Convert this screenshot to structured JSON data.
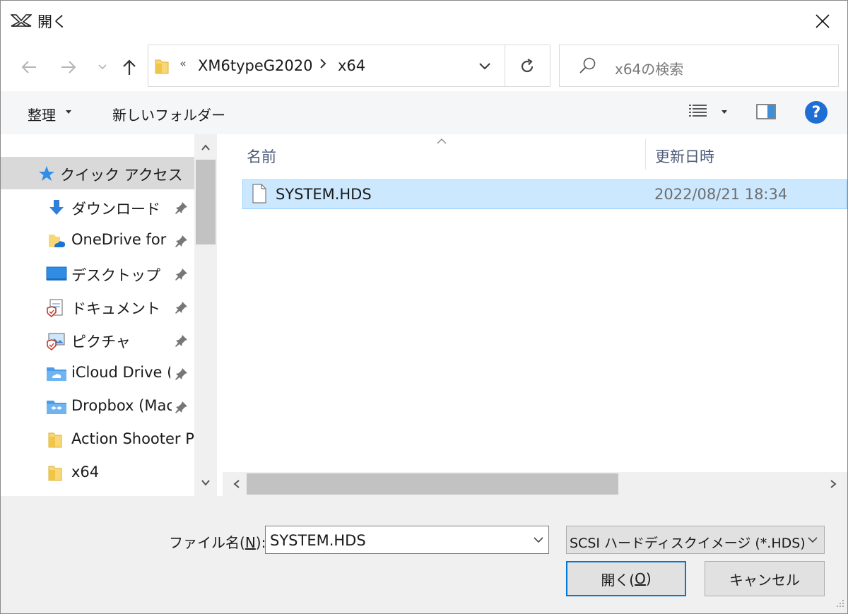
{
  "window": {
    "title": "開く",
    "app_icon": "xm6-logo-icon",
    "close_icon": "close-icon"
  },
  "nav": {
    "back_icon": "arrow-left-icon",
    "forward_icon": "arrow-right-icon",
    "recent_icon": "chevron-down-icon",
    "up_icon": "arrow-up-icon",
    "address": {
      "overflow": "«",
      "crumbs": [
        "XM6typeG2020",
        "x64"
      ]
    },
    "refresh_icon": "refresh-icon",
    "search_placeholder": "x64の検索"
  },
  "toolbar": {
    "organize": "整理",
    "new_folder": "新しいフォルダー",
    "view_icon": "details-view-icon",
    "preview_icon": "preview-pane-icon",
    "help": "?"
  },
  "navpane": {
    "items": [
      {
        "label": "クイック アクセス",
        "icon": "star-icon",
        "pinned": false,
        "selected": true
      },
      {
        "label": "ダウンロード",
        "icon": "download-icon",
        "pinned": true
      },
      {
        "label": "OneDrive for",
        "icon": "onedrive-folder-icon",
        "pinned": true
      },
      {
        "label": "デスクトップ",
        "icon": "desktop-icon",
        "pinned": true
      },
      {
        "label": "ドキュメント",
        "icon": "documents-icon",
        "pinned": true
      },
      {
        "label": "ピクチャ",
        "icon": "pictures-icon",
        "pinned": true
      },
      {
        "label": "iCloud Drive (",
        "icon": "icloud-folder-icon",
        "pinned": true
      },
      {
        "label": "Dropbox (Mac",
        "icon": "dropbox-folder-icon",
        "pinned": true
      },
      {
        "label": "Action Shooter P",
        "icon": "folder-icon",
        "pinned": false
      },
      {
        "label": "x64",
        "icon": "folder-icon",
        "pinned": false
      }
    ]
  },
  "files": {
    "columns": {
      "name": "名前",
      "date": "更新日時"
    },
    "rows": [
      {
        "name": "SYSTEM.HDS",
        "date": "2022/08/21 18:34",
        "selected": true
      }
    ]
  },
  "bottom": {
    "filename_label": "ファイル名(",
    "filename_accel": "N",
    "filename_label_end": "):",
    "filename_value": "SYSTEM.HDS",
    "filetype": "SCSI ハードディスクイメージ (*.HDS)",
    "open_label": "開く(",
    "open_accel": "O",
    "open_label_end": ")",
    "cancel_label": "キャンセル"
  },
  "colors": {
    "selection": "#cce8ff",
    "accent": "#0078d7",
    "help": "#1f6ed4"
  }
}
